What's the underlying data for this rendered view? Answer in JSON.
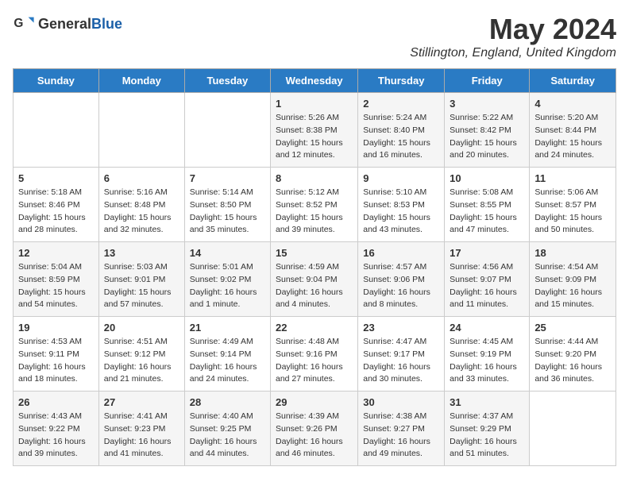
{
  "header": {
    "logo_general": "General",
    "logo_blue": "Blue",
    "month_title": "May 2024",
    "location": "Stillington, England, United Kingdom"
  },
  "weekdays": [
    "Sunday",
    "Monday",
    "Tuesday",
    "Wednesday",
    "Thursday",
    "Friday",
    "Saturday"
  ],
  "weeks": [
    [
      {
        "day": "",
        "info": ""
      },
      {
        "day": "",
        "info": ""
      },
      {
        "day": "",
        "info": ""
      },
      {
        "day": "1",
        "info": "Sunrise: 5:26 AM\nSunset: 8:38 PM\nDaylight: 15 hours and 12 minutes."
      },
      {
        "day": "2",
        "info": "Sunrise: 5:24 AM\nSunset: 8:40 PM\nDaylight: 15 hours and 16 minutes."
      },
      {
        "day": "3",
        "info": "Sunrise: 5:22 AM\nSunset: 8:42 PM\nDaylight: 15 hours and 20 minutes."
      },
      {
        "day": "4",
        "info": "Sunrise: 5:20 AM\nSunset: 8:44 PM\nDaylight: 15 hours and 24 minutes."
      }
    ],
    [
      {
        "day": "5",
        "info": "Sunrise: 5:18 AM\nSunset: 8:46 PM\nDaylight: 15 hours and 28 minutes."
      },
      {
        "day": "6",
        "info": "Sunrise: 5:16 AM\nSunset: 8:48 PM\nDaylight: 15 hours and 32 minutes."
      },
      {
        "day": "7",
        "info": "Sunrise: 5:14 AM\nSunset: 8:50 PM\nDaylight: 15 hours and 35 minutes."
      },
      {
        "day": "8",
        "info": "Sunrise: 5:12 AM\nSunset: 8:52 PM\nDaylight: 15 hours and 39 minutes."
      },
      {
        "day": "9",
        "info": "Sunrise: 5:10 AM\nSunset: 8:53 PM\nDaylight: 15 hours and 43 minutes."
      },
      {
        "day": "10",
        "info": "Sunrise: 5:08 AM\nSunset: 8:55 PM\nDaylight: 15 hours and 47 minutes."
      },
      {
        "day": "11",
        "info": "Sunrise: 5:06 AM\nSunset: 8:57 PM\nDaylight: 15 hours and 50 minutes."
      }
    ],
    [
      {
        "day": "12",
        "info": "Sunrise: 5:04 AM\nSunset: 8:59 PM\nDaylight: 15 hours and 54 minutes."
      },
      {
        "day": "13",
        "info": "Sunrise: 5:03 AM\nSunset: 9:01 PM\nDaylight: 15 hours and 57 minutes."
      },
      {
        "day": "14",
        "info": "Sunrise: 5:01 AM\nSunset: 9:02 PM\nDaylight: 16 hours and 1 minute."
      },
      {
        "day": "15",
        "info": "Sunrise: 4:59 AM\nSunset: 9:04 PM\nDaylight: 16 hours and 4 minutes."
      },
      {
        "day": "16",
        "info": "Sunrise: 4:57 AM\nSunset: 9:06 PM\nDaylight: 16 hours and 8 minutes."
      },
      {
        "day": "17",
        "info": "Sunrise: 4:56 AM\nSunset: 9:07 PM\nDaylight: 16 hours and 11 minutes."
      },
      {
        "day": "18",
        "info": "Sunrise: 4:54 AM\nSunset: 9:09 PM\nDaylight: 16 hours and 15 minutes."
      }
    ],
    [
      {
        "day": "19",
        "info": "Sunrise: 4:53 AM\nSunset: 9:11 PM\nDaylight: 16 hours and 18 minutes."
      },
      {
        "day": "20",
        "info": "Sunrise: 4:51 AM\nSunset: 9:12 PM\nDaylight: 16 hours and 21 minutes."
      },
      {
        "day": "21",
        "info": "Sunrise: 4:49 AM\nSunset: 9:14 PM\nDaylight: 16 hours and 24 minutes."
      },
      {
        "day": "22",
        "info": "Sunrise: 4:48 AM\nSunset: 9:16 PM\nDaylight: 16 hours and 27 minutes."
      },
      {
        "day": "23",
        "info": "Sunrise: 4:47 AM\nSunset: 9:17 PM\nDaylight: 16 hours and 30 minutes."
      },
      {
        "day": "24",
        "info": "Sunrise: 4:45 AM\nSunset: 9:19 PM\nDaylight: 16 hours and 33 minutes."
      },
      {
        "day": "25",
        "info": "Sunrise: 4:44 AM\nSunset: 9:20 PM\nDaylight: 16 hours and 36 minutes."
      }
    ],
    [
      {
        "day": "26",
        "info": "Sunrise: 4:43 AM\nSunset: 9:22 PM\nDaylight: 16 hours and 39 minutes."
      },
      {
        "day": "27",
        "info": "Sunrise: 4:41 AM\nSunset: 9:23 PM\nDaylight: 16 hours and 41 minutes."
      },
      {
        "day": "28",
        "info": "Sunrise: 4:40 AM\nSunset: 9:25 PM\nDaylight: 16 hours and 44 minutes."
      },
      {
        "day": "29",
        "info": "Sunrise: 4:39 AM\nSunset: 9:26 PM\nDaylight: 16 hours and 46 minutes."
      },
      {
        "day": "30",
        "info": "Sunrise: 4:38 AM\nSunset: 9:27 PM\nDaylight: 16 hours and 49 minutes."
      },
      {
        "day": "31",
        "info": "Sunrise: 4:37 AM\nSunset: 9:29 PM\nDaylight: 16 hours and 51 minutes."
      },
      {
        "day": "",
        "info": ""
      }
    ]
  ]
}
